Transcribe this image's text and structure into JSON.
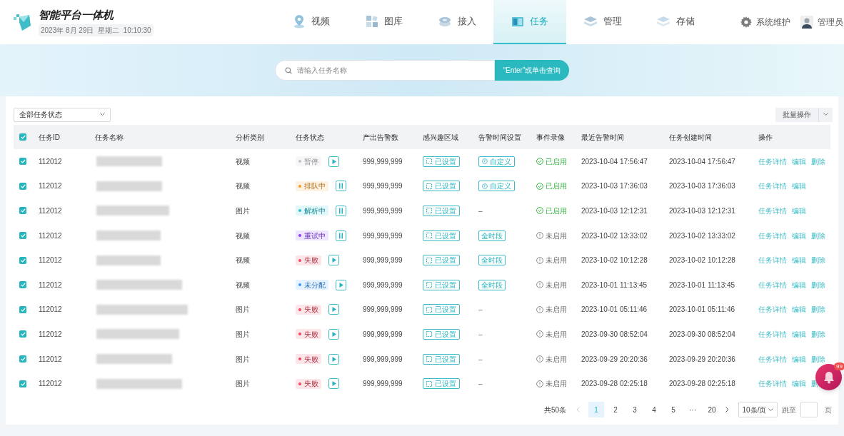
{
  "header": {
    "title": "智能平台一体机",
    "datetime": "2023年 8月 29日  星期二  10:10:30"
  },
  "nav": [
    {
      "kind": "video",
      "label": "视频",
      "selected": false
    },
    {
      "kind": "gallery",
      "label": "图库",
      "selected": false
    },
    {
      "kind": "access",
      "label": "接入",
      "selected": false
    },
    {
      "kind": "task",
      "label": "任务",
      "selected": true
    },
    {
      "kind": "manage",
      "label": "管理",
      "selected": false
    },
    {
      "kind": "storage",
      "label": "存储",
      "selected": false
    }
  ],
  "system": "系统维护",
  "user": "管理员",
  "search": {
    "placeholder": "请输入任务名称",
    "button": "“Enter”或单击查询"
  },
  "filter": {
    "value": "全部任务状态"
  },
  "batch": "批量操作",
  "table": {
    "select_all": true,
    "columns": [
      "任务ID",
      "任务名称",
      "分析类别",
      "任务状态",
      "产出告警数",
      "感兴趣区域",
      "告警时间设置",
      "事件录像",
      "最近告警时间",
      "任务创建时间",
      "操作"
    ],
    "rows": [
      {
        "checked": true,
        "id": "112012",
        "type": "视频",
        "status": {
          "label": "暂停",
          "color": "#c0c4cc"
        },
        "action": {
          "kind": "play"
        },
        "alerts": "999,999,999",
        "roi": "已设置",
        "alert_time": {
          "kind": "custom",
          "label": "自定义"
        },
        "recording": {
          "enabled": true,
          "label": "已启用"
        },
        "last_alert": "2023-10-04 17:56:47",
        "created": "2023-10-04 17:56:47",
        "ops": [
          "任务详情",
          "编辑",
          "删除"
        ]
      },
      {
        "checked": true,
        "id": "112012",
        "type": "视频",
        "status": {
          "label": "排队中",
          "color": "#f59a23"
        },
        "action": {
          "kind": "pause"
        },
        "alerts": "999,999,999",
        "roi": "已设置",
        "alert_time": {
          "kind": "custom",
          "label": "自定义"
        },
        "recording": {
          "enabled": true,
          "label": "已启用"
        },
        "last_alert": "2023-10-03 17:36:03",
        "created": "2023-10-03 17:36:03",
        "ops": [
          "任务详情",
          "编辑"
        ]
      },
      {
        "checked": true,
        "id": "112012",
        "type": "图片",
        "status": {
          "label": "解析中",
          "color": "#1fc3d3"
        },
        "action": {
          "kind": "pause"
        },
        "alerts": "999,999,999",
        "roi": "已设置",
        "alert_time": {
          "kind": "none",
          "label": "–"
        },
        "recording": {
          "enabled": true,
          "label": "已启用"
        },
        "last_alert": "2023-10-03 12:12:31",
        "created": "2023-10-03 12:12:31",
        "ops": [
          "任务详情",
          "编辑"
        ]
      },
      {
        "checked": true,
        "id": "112012",
        "type": "视频",
        "status": {
          "label": "重试中",
          "color": "#8a3ffc"
        },
        "action": {
          "kind": "pause"
        },
        "alerts": "999,999,999",
        "roi": "已设置",
        "alert_time": {
          "kind": "all",
          "label": "全时段"
        },
        "recording": {
          "enabled": false,
          "label": "未启用"
        },
        "last_alert": "2023-10-02 13:33:02",
        "created": "2023-10-02 13:33:02",
        "ops": [
          "任务详情",
          "编辑",
          "删除"
        ]
      },
      {
        "checked": true,
        "id": "112012",
        "type": "视频",
        "status": {
          "label": "失败",
          "color": "#f0465b"
        },
        "action": {
          "kind": "play"
        },
        "alerts": "999,999,999",
        "roi": "已设置",
        "alert_time": {
          "kind": "all",
          "label": "全时段"
        },
        "recording": {
          "enabled": false,
          "label": "未启用"
        },
        "last_alert": "2023-10-02 10:12:28",
        "created": "2023-10-02 10:12:28",
        "ops": [
          "任务详情",
          "编辑",
          "删除"
        ]
      },
      {
        "checked": true,
        "id": "112012",
        "type": "视频",
        "status": {
          "label": "未分配",
          "color": "#3a9bfd"
        },
        "action": {
          "kind": "play"
        },
        "alerts": "999,999,999",
        "roi": "已设置",
        "alert_time": {
          "kind": "all",
          "label": "全时段"
        },
        "recording": {
          "enabled": false,
          "label": "未启用"
        },
        "last_alert": "2023-10-01 11:13:45",
        "created": "2023-10-01 11:13:45",
        "ops": [
          "任务详情",
          "编辑",
          "删除"
        ]
      },
      {
        "checked": true,
        "id": "112012",
        "type": "图片",
        "status": {
          "label": "失败",
          "color": "#f0465b"
        },
        "action": {
          "kind": "play"
        },
        "alerts": "999,999,999",
        "roi": "已设置",
        "alert_time": {
          "kind": "none",
          "label": "–"
        },
        "recording": {
          "enabled": false,
          "label": "未启用"
        },
        "last_alert": "2023-10-01 05:11:46",
        "created": "2023-10-01 05:11:46",
        "ops": [
          "任务详情",
          "编辑",
          "删除"
        ]
      },
      {
        "checked": true,
        "id": "112012",
        "type": "图片",
        "status": {
          "label": "失败",
          "color": "#f0465b"
        },
        "action": {
          "kind": "play"
        },
        "alerts": "999,999,999",
        "roi": "已设置",
        "alert_time": {
          "kind": "none",
          "label": "–"
        },
        "recording": {
          "enabled": false,
          "label": "未启用"
        },
        "last_alert": "2023-09-30 08:52:04",
        "created": "2023-09-30 08:52:04",
        "ops": [
          "任务详情",
          "编辑",
          "删除"
        ]
      },
      {
        "checked": true,
        "id": "112012",
        "type": "图片",
        "status": {
          "label": "失败",
          "color": "#f0465b"
        },
        "action": {
          "kind": "play"
        },
        "alerts": "999,999,999",
        "roi": "已设置",
        "alert_time": {
          "kind": "none",
          "label": "–"
        },
        "recording": {
          "enabled": false,
          "label": "未启用"
        },
        "last_alert": "2023-09-29 20:20:36",
        "created": "2023-09-29 20:20:36",
        "ops": [
          "任务详情",
          "编辑",
          "删除"
        ]
      },
      {
        "checked": true,
        "id": "112012",
        "type": "图片",
        "status": {
          "label": "失败",
          "color": "#f0465b"
        },
        "action": {
          "kind": "play"
        },
        "alerts": "999,999,999",
        "roi": "已设置",
        "alert_time": {
          "kind": "none",
          "label": "–"
        },
        "recording": {
          "enabled": false,
          "label": "未启用"
        },
        "last_alert": "2023-09-28 02:25:18",
        "created": "2023-09-28 02:25:18",
        "ops": [
          "任务详情",
          "编辑",
          "删"
        ]
      }
    ]
  },
  "pagination": {
    "total": "共50条",
    "pages": [
      {
        "label": "1",
        "selected": true
      },
      {
        "label": "2",
        "selected": false
      },
      {
        "label": "3",
        "selected": false
      },
      {
        "label": "4",
        "selected": false
      },
      {
        "label": "5",
        "selected": false
      },
      {
        "label": "···",
        "selected": false
      },
      {
        "label": "20",
        "selected": false
      }
    ],
    "page_size": "10条/页",
    "jump_label": "跳至",
    "page_suffix": "页"
  },
  "notifications": {
    "count": "99"
  }
}
